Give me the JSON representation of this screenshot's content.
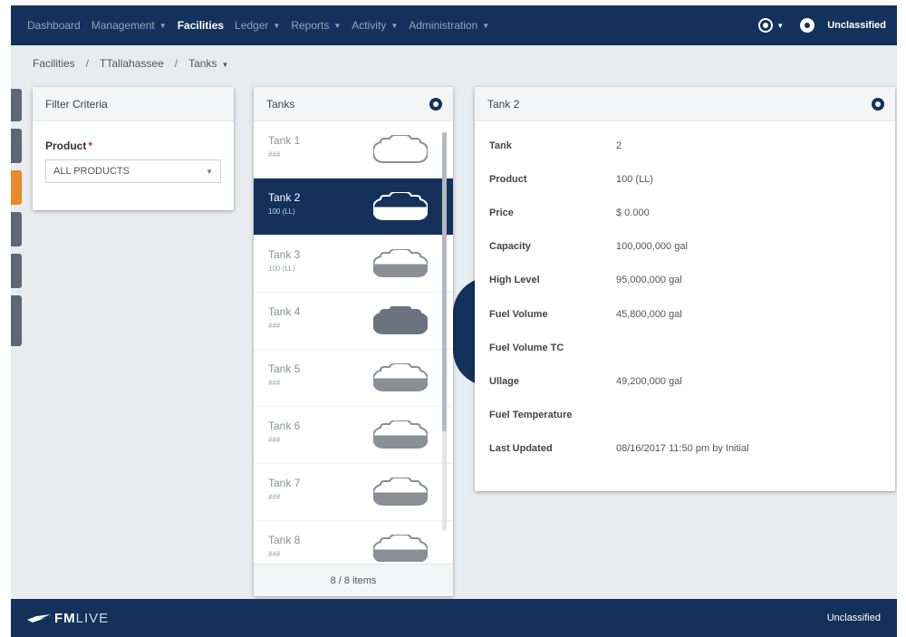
{
  "nav": {
    "items": [
      {
        "label": "Dashboard",
        "dropdown": false,
        "active": false
      },
      {
        "label": "Management",
        "dropdown": true,
        "active": false
      },
      {
        "label": "Facilities",
        "dropdown": false,
        "active": true
      },
      {
        "label": "Ledger",
        "dropdown": true,
        "active": false
      },
      {
        "label": "Reports",
        "dropdown": true,
        "active": false
      },
      {
        "label": "Activity",
        "dropdown": true,
        "active": false
      },
      {
        "label": "Administration",
        "dropdown": true,
        "active": false
      }
    ],
    "classification": "Unclassified"
  },
  "breadcrumb": {
    "items": [
      "Facilities",
      "TTallahassee",
      "Tanks"
    ]
  },
  "filter": {
    "title": "Filter Criteria",
    "product_label": "Product",
    "required_mark": "*",
    "product_value": "ALL PRODUCTS"
  },
  "tanks": {
    "title": "Tanks",
    "footer": "8 / 8 items",
    "items": [
      {
        "name": "Tank 1",
        "product": "###",
        "selected": false,
        "fill": 0.0,
        "icon": "tank-icon",
        "color": "#8a8f96"
      },
      {
        "name": "Tank 2",
        "product": "100 (LL)",
        "selected": true,
        "fill": 0.45,
        "icon": "tank-icon",
        "color": "#ffffff"
      },
      {
        "name": "Tank 3",
        "product": "100 (LL)",
        "selected": false,
        "fill": 0.45,
        "icon": "tank-icon",
        "color": "#8a8f96"
      },
      {
        "name": "Tank 4",
        "product": "###",
        "selected": false,
        "fill": 1.0,
        "icon": "tank-icon",
        "color": "#6b7280"
      },
      {
        "name": "Tank 5",
        "product": "###",
        "selected": false,
        "fill": 0.45,
        "icon": "tank-icon",
        "color": "#8a8f96"
      },
      {
        "name": "Tank 6",
        "product": "###",
        "selected": false,
        "fill": 0.45,
        "icon": "tank-icon",
        "color": "#8a8f96"
      },
      {
        "name": "Tank 7",
        "product": "###",
        "selected": false,
        "fill": 0.45,
        "icon": "tank-icon",
        "color": "#8a8f96"
      },
      {
        "name": "Tank 8",
        "product": "###",
        "selected": false,
        "fill": 0.45,
        "icon": "tank-icon",
        "color": "#8a8f96"
      }
    ]
  },
  "detail": {
    "title": "Tank 2",
    "rows": [
      {
        "key": "Tank",
        "value": "2"
      },
      {
        "key": "Product",
        "value": "100 (LL)"
      },
      {
        "key": "Price",
        "value": "$ 0.000"
      },
      {
        "key": "Capacity",
        "value": "100,000,000 gal"
      },
      {
        "key": "High Level",
        "value": "95,000,000 gal"
      },
      {
        "key": "Fuel Volume",
        "value": "45,800,000 gal"
      },
      {
        "key": "Fuel Volume TC",
        "value": ""
      },
      {
        "key": "Ullage",
        "value": "49,200,000 gal"
      },
      {
        "key": "Fuel Temperature",
        "value": ""
      },
      {
        "key": "Last Updated",
        "value": "08/16/2017 11:50 pm by Initial"
      }
    ]
  },
  "footer": {
    "brand_bold": "FM",
    "brand_light": "LIVE",
    "classification": "Unclassified"
  },
  "colors": {
    "navy": "#13315a",
    "accent_tab": "#e8892b",
    "side_tab": "#5f6774"
  }
}
